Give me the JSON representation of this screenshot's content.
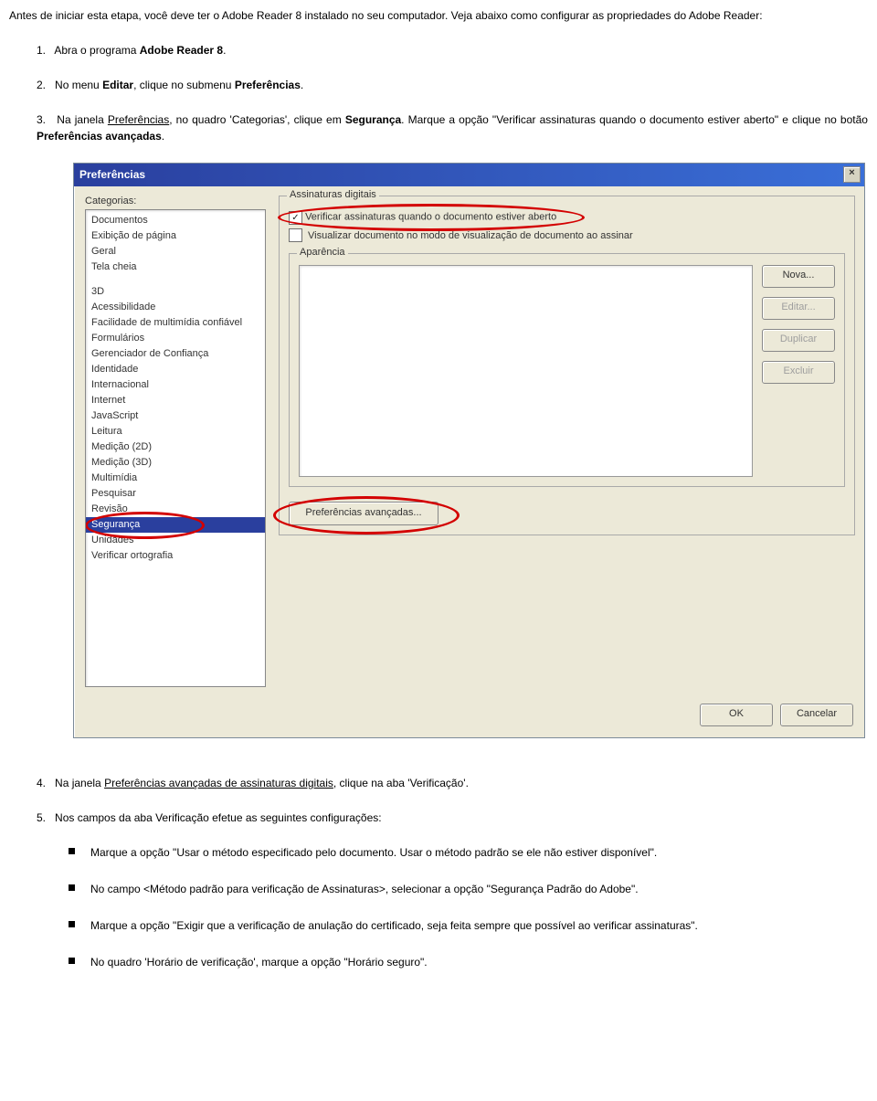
{
  "intro": "Antes de iniciar esta etapa, você deve ter o Adobe Reader 8 instalado no seu computador. Veja abaixo como configurar as propriedades do Adobe Reader:",
  "steps": {
    "s1": {
      "num": "1.",
      "text_a": "Abra o programa ",
      "bold": "Adobe Reader 8",
      "text_b": "."
    },
    "s2": {
      "num": "2.",
      "text_a": "No menu ",
      "bold1": "Editar",
      "text_b": ", clique no submenu ",
      "bold2": "Preferências",
      "text_c": "."
    },
    "s3": {
      "num": "3.",
      "part1": "Na  janela  ",
      "underline1": "Preferências",
      "part2": ",  no  quadro  'Categorias',  clique  em  ",
      "bold1": "Segurança",
      "part3": ".  Marque  a  opção  \"Verificar assinaturas quando o documento estiver aberto\" e clique no botão ",
      "bold2": "Preferências avançadas",
      "part4": "."
    },
    "s4": {
      "num": "4.",
      "part1": "Na janela ",
      "underline1": "Preferências avançadas de assinaturas digitais",
      "part2": ", clique na aba 'Verificação'."
    },
    "s5": {
      "num": "5.",
      "text": "Nos campos da aba Verificação efetue as seguintes configurações:"
    }
  },
  "dialog": {
    "title": "Preferências",
    "categories_label": "Categorias:",
    "categories": [
      "Documentos",
      "Exibição de página",
      "Geral",
      "Tela cheia",
      "",
      "3D",
      "Acessibilidade",
      "Facilidade de multimídia confiável",
      "Formulários",
      "Gerenciador de Confiança",
      "Identidade",
      "Internacional",
      "Internet",
      "JavaScript",
      "Leitura",
      "Medição (2D)",
      "Medição (3D)",
      "Multimídia",
      "Pesquisar",
      "Revisão",
      "Segurança",
      "Unidades",
      "Verificar ortografia"
    ],
    "group1_legend": "Assinaturas digitais",
    "chk1_label": "Verificar assinaturas quando o documento estiver aberto",
    "chk2_label": "Visualizar documento no modo de visualização de documento ao assinar",
    "aparencia_legend": "Aparência",
    "btn_nova": "Nova...",
    "btn_editar": "Editar...",
    "btn_duplicar": "Duplicar",
    "btn_excluir": "Excluir",
    "btn_prefav": "Preferências avançadas...",
    "btn_ok": "OK",
    "btn_cancel": "Cancelar"
  },
  "bullets": {
    "b1": "Marque a opção \"Usar o método especificado pelo documento. Usar o método padrão se ele não estiver disponível\".",
    "b2": "No campo <Método padrão para verificação de Assinaturas>, selecionar a opção \"Segurança Padrão do Adobe\".",
    "b3": "Marque a opção \"Exigir que a verificação de anulação do certificado, seja feita sempre que possível ao verificar assinaturas\".",
    "b4": "No quadro 'Horário de verificação', marque a opção \"Horário seguro\"."
  }
}
